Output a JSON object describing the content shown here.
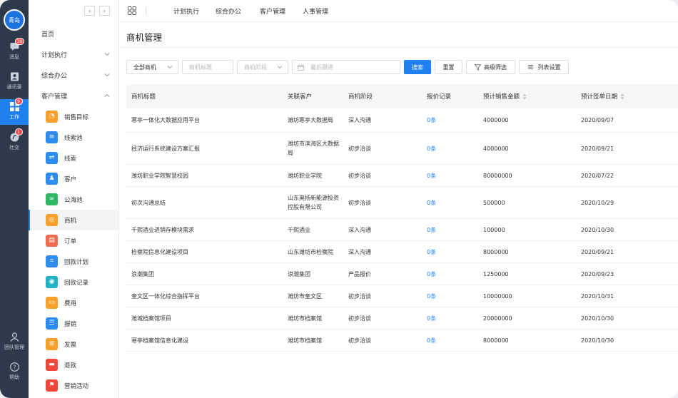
{
  "rail": {
    "avatar": "青岛",
    "items": [
      {
        "label": "消息",
        "badge": "38",
        "icon": "message-icon"
      },
      {
        "label": "通讯录",
        "badge": "",
        "icon": "contacts-icon"
      },
      {
        "label": "工作",
        "badge": "9",
        "icon": "work-grid-icon"
      },
      {
        "label": "社交",
        "badge": "1",
        "icon": "social-icon"
      }
    ],
    "bottom": [
      {
        "label": "团队管理",
        "icon": "team-icon"
      },
      {
        "label": "帮助",
        "icon": "help-icon"
      }
    ]
  },
  "sidebar": {
    "collapse_left": "‹",
    "collapse_right": "›",
    "groups": [
      {
        "label": "首页"
      },
      {
        "label": "计划执行"
      },
      {
        "label": "综合办公"
      },
      {
        "label": "客户管理"
      }
    ],
    "items": [
      {
        "label": "销售目标",
        "color": "#f7a02a",
        "icon": "target-icon"
      },
      {
        "label": "线索池",
        "color": "#2d8cf0",
        "icon": "clue-pool-icon"
      },
      {
        "label": "线索",
        "color": "#2d8cf0",
        "icon": "clue-icon"
      },
      {
        "label": "客户",
        "color": "#2d8cf0",
        "icon": "customer-icon"
      },
      {
        "label": "公海池",
        "color": "#30b764",
        "icon": "sea-pool-icon"
      },
      {
        "label": "商机",
        "color": "#f7a02a",
        "icon": "opportunity-icon"
      },
      {
        "label": "订单",
        "color": "#f06a4f",
        "icon": "order-icon"
      },
      {
        "label": "回款计划",
        "color": "#2d8cf0",
        "icon": "payment-plan-icon"
      },
      {
        "label": "回款记录",
        "color": "#20b3c5",
        "icon": "payment-record-icon"
      },
      {
        "label": "费用",
        "color": "#f7a02a",
        "icon": "expense-icon"
      },
      {
        "label": "报销",
        "color": "#2d8cf0",
        "icon": "reimburse-icon"
      },
      {
        "label": "发票",
        "color": "#f7a02a",
        "icon": "invoice-icon"
      },
      {
        "label": "退款",
        "color": "#f0473b",
        "icon": "refund-icon"
      },
      {
        "label": "营销活动",
        "color": "#f0473b",
        "icon": "campaign-icon"
      }
    ]
  },
  "topbar": {
    "tabs": [
      "计划执行",
      "综合办公",
      "客户管理",
      "人事管理"
    ]
  },
  "page": {
    "title": "商机管理"
  },
  "filters": {
    "all_opportunities": "全部商机",
    "title_placeholder": "商机标题",
    "stage_placeholder": "商机阶段",
    "followup_placeholder": "最后跟进",
    "search": "搜索",
    "reset": "重置",
    "advanced": "高级筛选",
    "columns": "列表设置"
  },
  "table": {
    "headers": [
      "商机标题",
      "关联客户",
      "商机阶段",
      "报价记录",
      "预计销售金额",
      "预计签单日期"
    ],
    "rows": [
      [
        "寒亭一体化大数据应用平台",
        "潍坊寒亭大数据局",
        "深入沟通",
        "0条",
        "4000000",
        "2020/09/07"
      ],
      [
        "经济运行系统建设方案汇报",
        "潍坊市滨海区大数据局",
        "初步洽谈",
        "0条",
        "4000000",
        "2020/09/21"
      ],
      [
        "潍坊职业学院智慧校园",
        "潍坊职业学院",
        "初步洽谈",
        "0条",
        "80000000",
        "2020/07/22"
      ],
      [
        "初次沟通总结",
        "山东奥扬新能源投资控股有限公司",
        "初步洽谈",
        "0条",
        "500000",
        "2020/10/29"
      ],
      [
        "千熙酒业进销存模块需求",
        "千熙酒业",
        "深入沟通",
        "0条",
        "100000",
        "2020/10/30"
      ],
      [
        "检察院信息化建设项目",
        "山东潍坊市检察院",
        "深入沟通",
        "0条",
        "8000000",
        "2020/09/21"
      ],
      [
        "浪潮集团",
        "浪潮集团",
        "产品报价",
        "0条",
        "1250000",
        "2020/09/23"
      ],
      [
        "奎文区一体化综合指挥平台",
        "潍坊市奎文区",
        "初步洽谈",
        "0条",
        "10000000",
        "2020/10/31"
      ],
      [
        "潍城档案馆项目",
        "潍坊市档案馆",
        "初步洽谈",
        "0条",
        "20000000",
        "2020/10/30"
      ],
      [
        "寒亭档案馆信息化建设",
        "潍坊市档案馆",
        "初步洽谈",
        "0条",
        "8000000",
        "2020/10/30"
      ]
    ]
  }
}
